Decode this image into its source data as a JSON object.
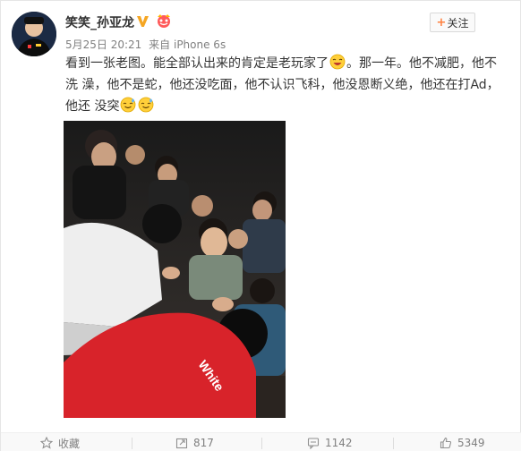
{
  "user": {
    "name": "笑笑_孙亚龙",
    "verified_color": "#f5a623"
  },
  "follow_button": {
    "plus": "+",
    "label": "关注"
  },
  "meta": {
    "date": "5月25日 20:21",
    "from": "来自",
    "device": "iPhone 6s"
  },
  "post": {
    "line1": "看到一张老图。能全部认出来的肯定是老玩家了",
    "line1b": "。那一年。他不减肥，他不洗",
    "line2": "澡，他不是蛇，他还没吃面，他不认识飞科，他没恩断义绝，他还在打Ad，他还",
    "line3": "没突"
  },
  "photo": {
    "shirt_text": "White"
  },
  "actions": {
    "favorite": "收藏",
    "repost": "817",
    "comment": "1142",
    "like": "5349"
  },
  "colors": {
    "accent": "#ff8140",
    "shirt_red": "#d8232a",
    "text_gray": "#808080"
  }
}
